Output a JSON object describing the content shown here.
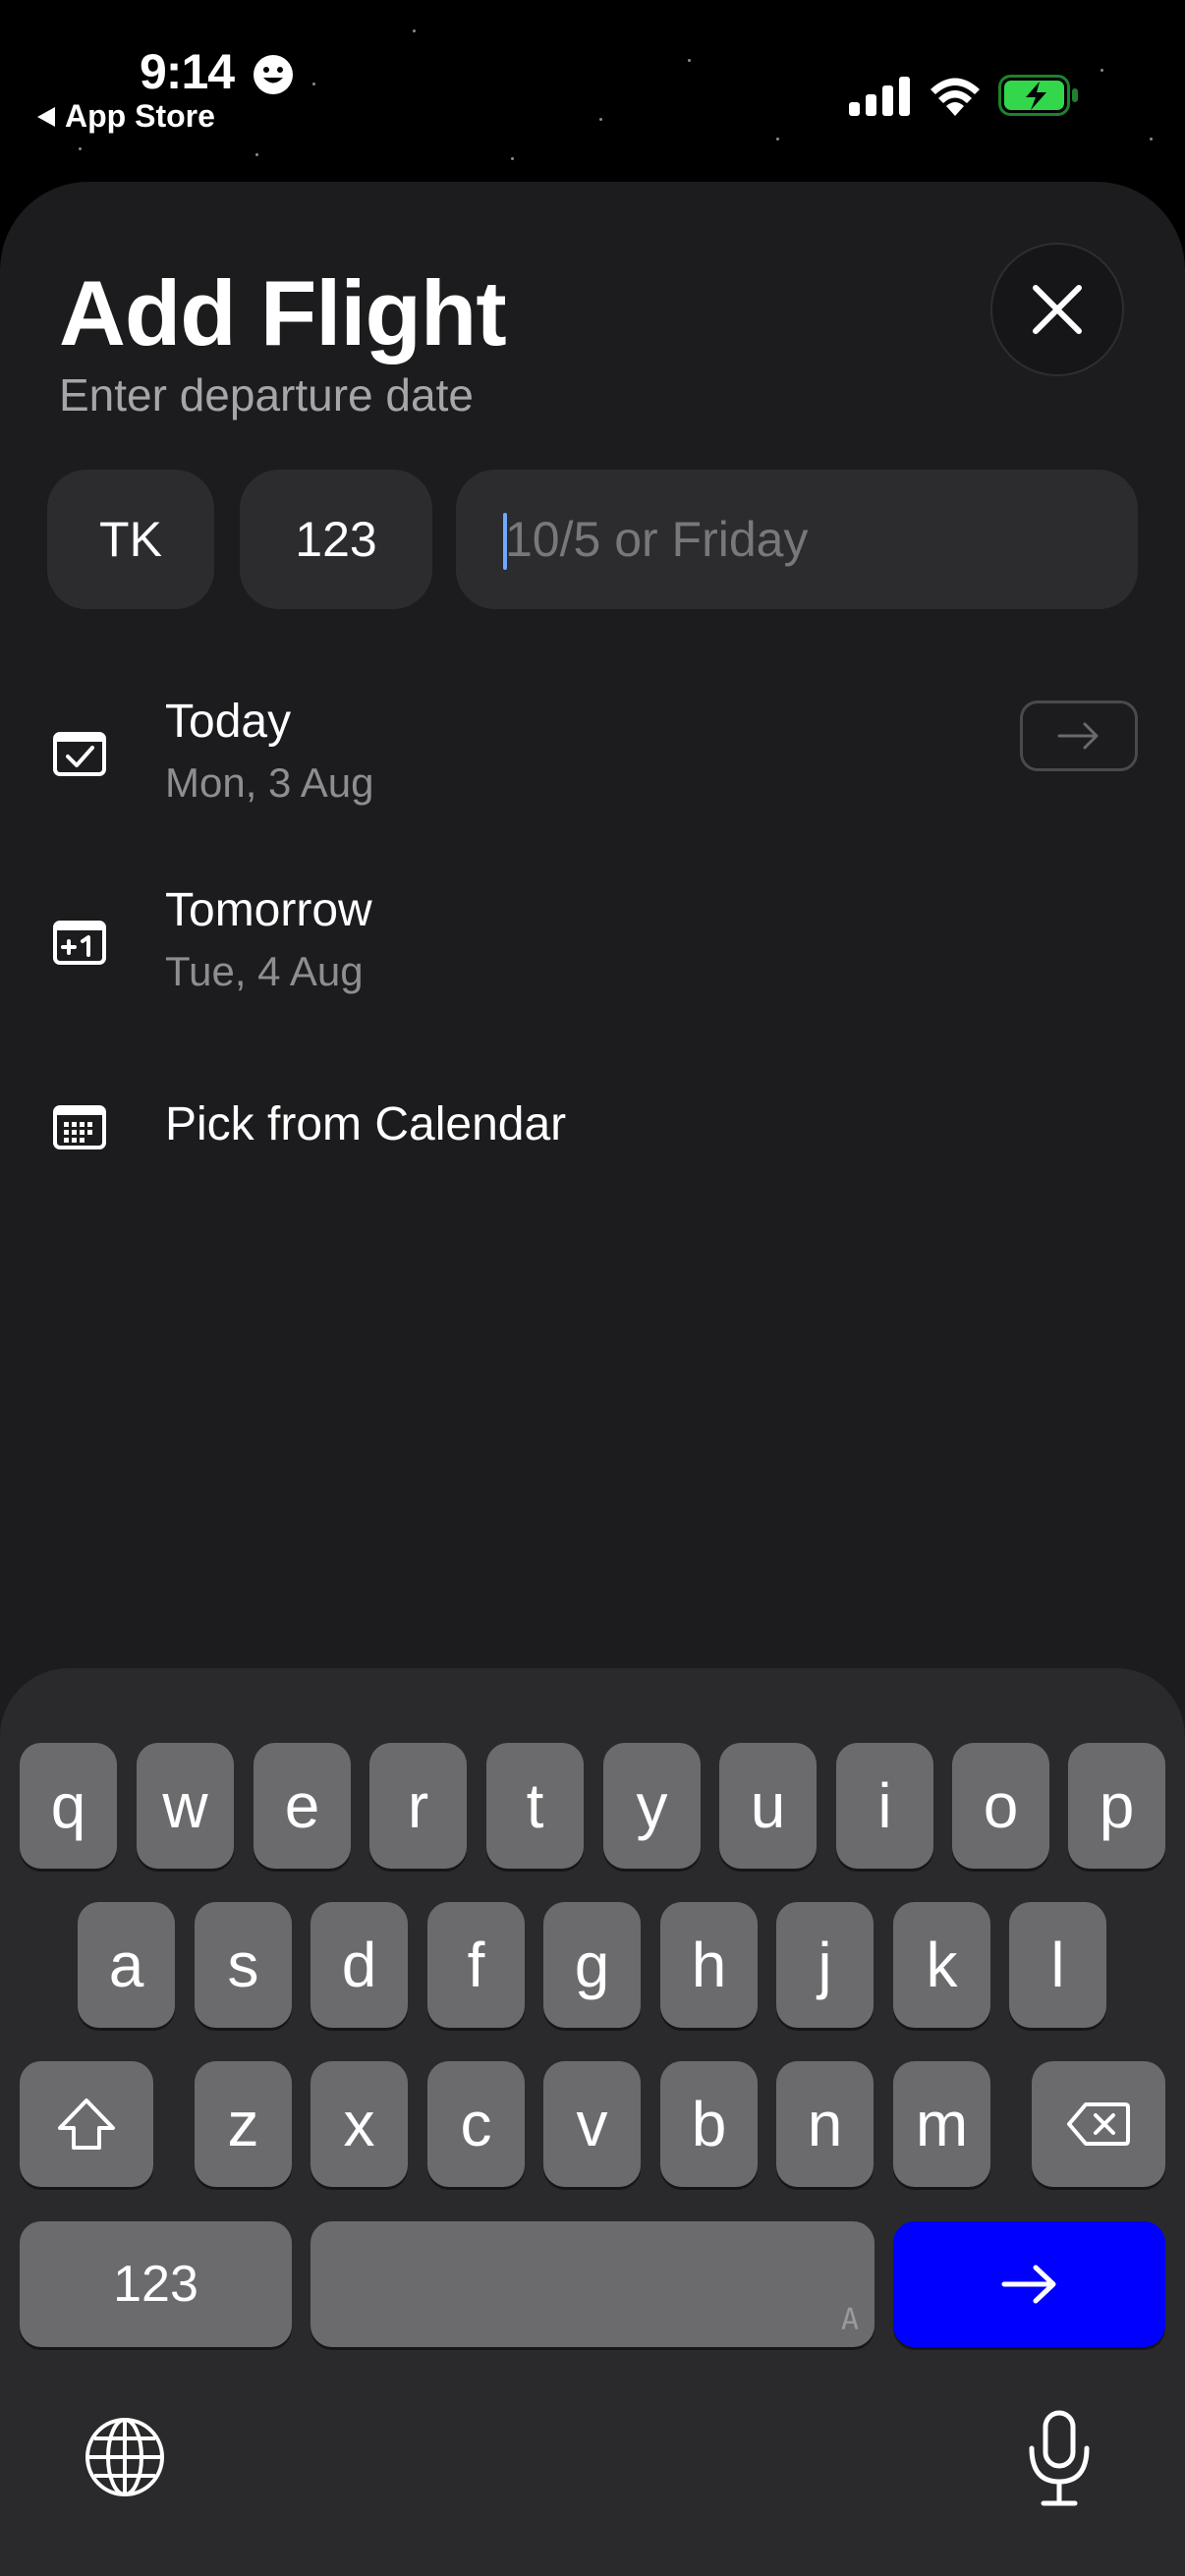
{
  "status_bar": {
    "time": "9:14",
    "back_label": "App Store"
  },
  "header": {
    "title": "Add Flight",
    "subtitle": "Enter departure date"
  },
  "flight": {
    "airline_code": "TK",
    "flight_number": "123",
    "date_placeholder": "10/5 or Friday",
    "date_value": ""
  },
  "options": [
    {
      "title": "Today",
      "subtitle": "Mon, 3 Aug",
      "icon": "calendar-check-icon"
    },
    {
      "title": "Tomorrow",
      "subtitle": "Tue, 4 Aug",
      "icon": "calendar-plus-one-icon"
    },
    {
      "title": "Pick from Calendar",
      "icon": "calendar-grid-icon"
    }
  ],
  "keyboard": {
    "row1": [
      "q",
      "w",
      "e",
      "r",
      "t",
      "y",
      "u",
      "i",
      "o",
      "p"
    ],
    "row2": [
      "a",
      "s",
      "d",
      "f",
      "g",
      "h",
      "j",
      "k",
      "l"
    ],
    "row3": [
      "z",
      "x",
      "c",
      "v",
      "b",
      "n",
      "m"
    ],
    "numbers_label": "123",
    "space_glyph": "A"
  },
  "colors": {
    "accent": "#0000ff",
    "sheet_bg": "#1c1c1e",
    "battery_green": "#32d74b"
  }
}
